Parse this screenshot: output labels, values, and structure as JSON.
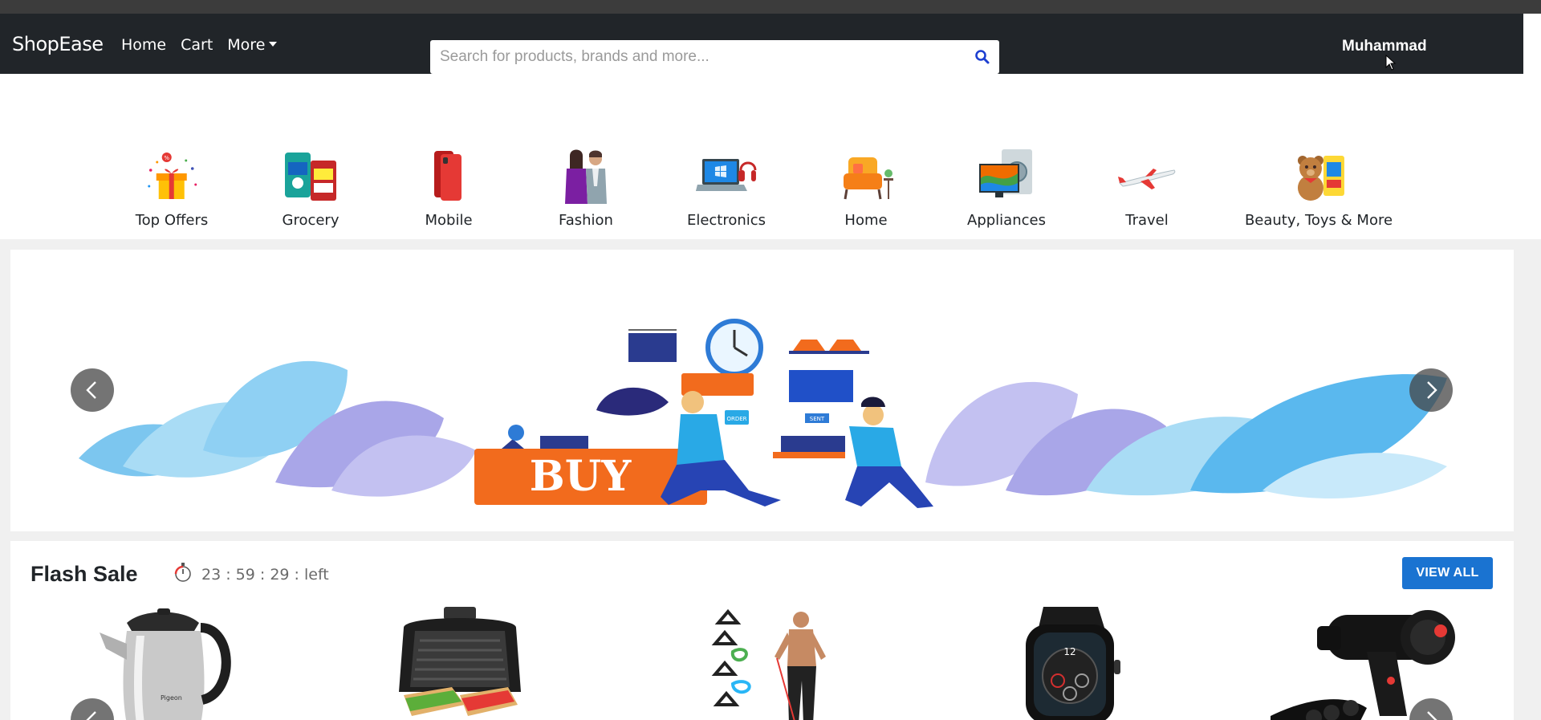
{
  "header": {
    "brand": "ShopEase",
    "nav": {
      "home": "Home",
      "cart": "Cart",
      "more": "More"
    },
    "search": {
      "placeholder": "Search for products, brands and more...",
      "value": ""
    },
    "user": "Muhammad"
  },
  "categories": [
    {
      "label": "Top Offers",
      "icon": "gift-icon"
    },
    {
      "label": "Grocery",
      "icon": "grocery-icon"
    },
    {
      "label": "Mobile",
      "icon": "mobile-phone-icon"
    },
    {
      "label": "Fashion",
      "icon": "fashion-icon"
    },
    {
      "label": "Electronics",
      "icon": "laptop-icon"
    },
    {
      "label": "Home",
      "icon": "armchair-icon"
    },
    {
      "label": "Appliances",
      "icon": "appliances-icon"
    },
    {
      "label": "Travel",
      "icon": "airplane-icon"
    },
    {
      "label": "Beauty, Toys & More",
      "icon": "teddy-bear-icon"
    }
  ],
  "banner": {
    "text": "BUY",
    "sign_1": "ORDER",
    "sign_2": "SENT"
  },
  "flash_sale": {
    "title": "Flash Sale",
    "timer": "23 : 59 : 29 : left",
    "view_all": "VIEW ALL",
    "kettle_brand": "Pigeon",
    "watch_time": "12"
  },
  "colors": {
    "navbar": "#212529",
    "accent": "#1a73d1",
    "buy_orange": "#f26b1d",
    "leaf_blue": "#7cc6ef",
    "leaf_purple": "#a9a6e8"
  }
}
